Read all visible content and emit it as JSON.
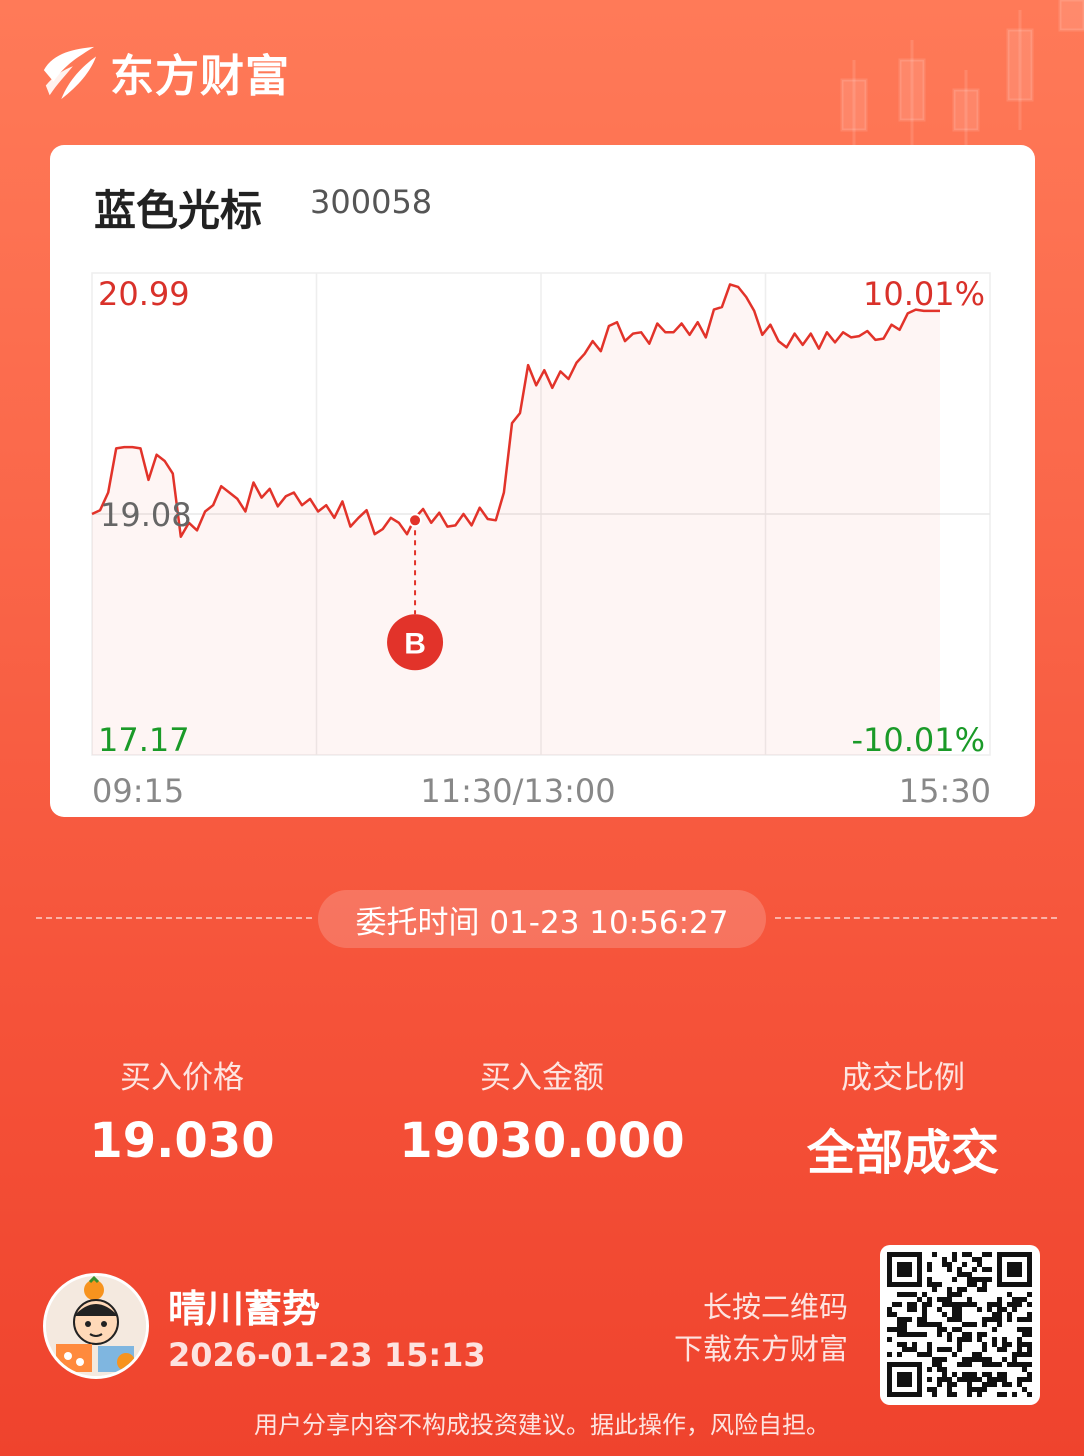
{
  "brand": {
    "name": "东方财富"
  },
  "stock": {
    "name": "蓝色光标",
    "code": "300058"
  },
  "chart_data": {
    "type": "line",
    "price_high": "20.99",
    "price_mid": "19.08",
    "price_low": "17.17",
    "pct_high": "10.01%",
    "pct_low": "-10.01%",
    "ylim": [
      17.17,
      20.99
    ],
    "time_labels": [
      "09:15",
      "11:30/13:00",
      "15:30"
    ],
    "buy_marker": {
      "label": "B",
      "price": 19.03
    },
    "series": [
      {
        "values": [
          19.08,
          19.11,
          19.25,
          19.6,
          19.61,
          19.61,
          19.6,
          19.35,
          19.55,
          19.5,
          19.4,
          18.9,
          19.01,
          18.95,
          19.1,
          19.15,
          19.3,
          19.25,
          19.2,
          19.1,
          19.33,
          19.21,
          19.28,
          19.14,
          19.22,
          19.25,
          19.15,
          19.2,
          19.1,
          19.15,
          19.05,
          19.18,
          18.98,
          19.05,
          19.11,
          18.92,
          18.96,
          19.05,
          19.01,
          18.92,
          19.05,
          19.12,
          19.01,
          19.09,
          18.98,
          18.99,
          19.08,
          18.99,
          19.13,
          19.04,
          19.03,
          19.25,
          19.8,
          19.88,
          20.26,
          20.1,
          20.22,
          20.08,
          20.21,
          20.15,
          20.28,
          20.35,
          20.45,
          20.37,
          20.57,
          20.6,
          20.45,
          20.51,
          20.52,
          20.43,
          20.59,
          20.52,
          20.52,
          20.59,
          20.5,
          20.6,
          20.48,
          20.7,
          20.72,
          20.9,
          20.88,
          20.8,
          20.69,
          20.5,
          20.58,
          20.45,
          20.4,
          20.51,
          20.42,
          20.51,
          20.39,
          20.52,
          20.44,
          20.52,
          20.48,
          20.49,
          20.53,
          20.46,
          20.47,
          20.58,
          20.54,
          20.67,
          20.7,
          20.69,
          20.69,
          20.69
        ]
      }
    ]
  },
  "order": {
    "time_text": "委托时间 01-23 10:56:27"
  },
  "stats": [
    {
      "label": "买入价格",
      "value": "19.030"
    },
    {
      "label": "买入金额",
      "value": "19030.000"
    },
    {
      "label": "成交比例",
      "value": "全部成交"
    }
  ],
  "user": {
    "name": "晴川蓄势",
    "time": "2026-01-23 15:13"
  },
  "qr_hint": {
    "line1": "长按二维码",
    "line2": "下载东方财富"
  },
  "disclaimer": "用户分享内容不构成投资建议。据此操作，风险自担。",
  "colors": {
    "up": "#e2332a",
    "down": "#1a9a28",
    "brand": "#f55239"
  }
}
